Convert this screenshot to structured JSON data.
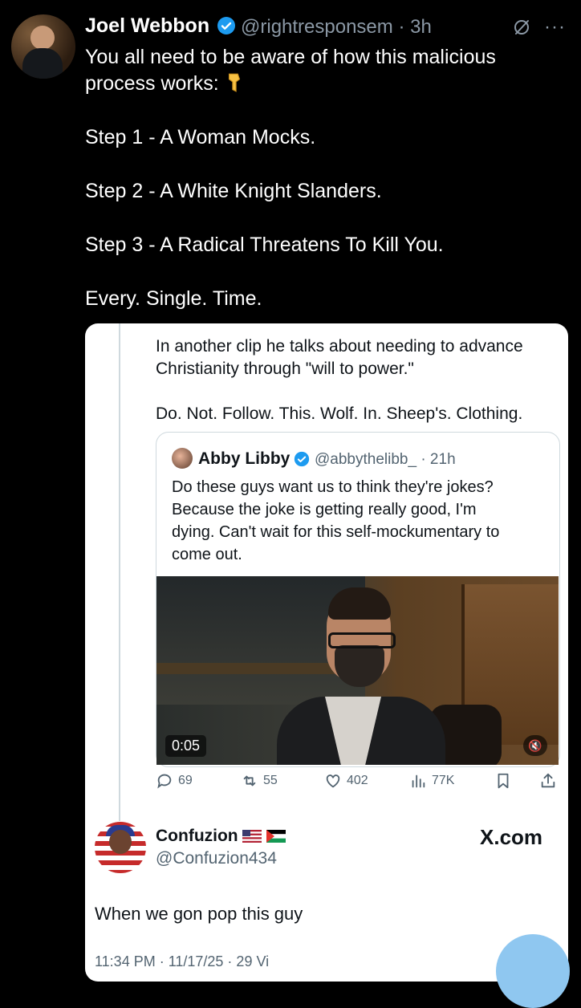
{
  "tweet": {
    "author_name": "Joel Webbon",
    "handle_time": "@rightresponsem · 3h",
    "line1": "You all need to be aware of how this malicious",
    "line2": "process works:",
    "step1": "Step 1 - A Woman Mocks.",
    "step2": "Step 2 - A White Knight Slanders.",
    "step3": "Step 3 - A Radical Threatens To Kill You.",
    "closing": "Every. Single. Time."
  },
  "quote": {
    "text1": "In another clip he talks about needing to advance",
    "text2": "Christianity through \"will to power.\"",
    "text3": "Do. Not. Follow. This. Wolf. In. Sheep's. Clothing.",
    "inner": {
      "author_name": "Abby Libby",
      "handle_time": "@abbythelibb_ · 21h",
      "line1": "Do these guys want us to think they're jokes?",
      "line2": "Because the joke is getting really good, I'm",
      "line3": "dying. Can't wait for this self-mockumentary to",
      "line4": "come out.",
      "video_time": "0:05"
    },
    "actions": {
      "replies": "69",
      "reposts": "55",
      "likes": "402",
      "views": "77K"
    }
  },
  "reply": {
    "author_name": "Confuzion",
    "handle": "@Confuzion434",
    "brand": "X.com",
    "text": "When we gon pop this guy",
    "meta": "11:34 PM · 11/17/25 · 29 Vi"
  },
  "colors": {
    "background": "#000000",
    "verified_blue": "#1d9bf0",
    "card_bg": "#ffffff",
    "fab": "#8fc7f0"
  }
}
